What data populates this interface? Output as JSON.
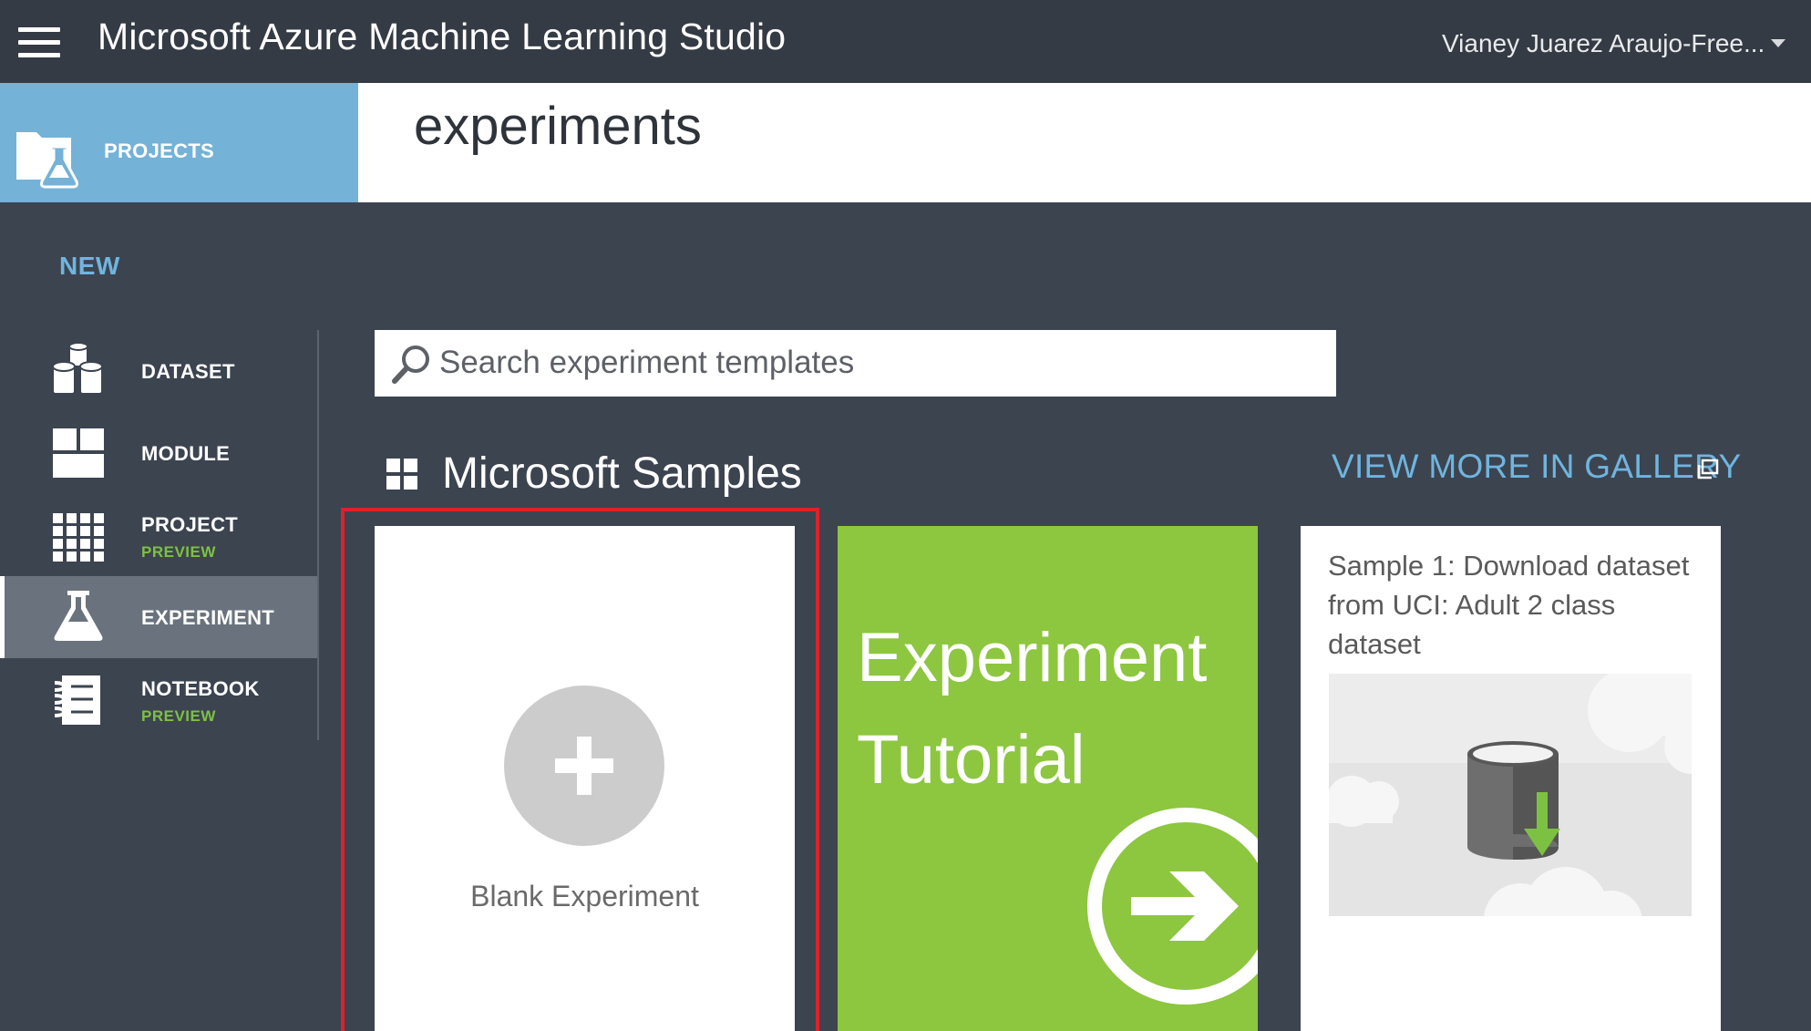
{
  "topbar": {
    "app_title": "Microsoft Azure Machine Learning Studio",
    "user_name": "Vianey Juarez Araujo-Free..."
  },
  "header": {
    "projects_label": "PROJECTS",
    "page_title": "experiments"
  },
  "nav": {
    "new_label": "NEW",
    "items": [
      {
        "label": "DATASET",
        "icon": "dataset-icon"
      },
      {
        "label": "MODULE",
        "icon": "module-icon"
      },
      {
        "label": "PROJECT",
        "sub": "PREVIEW",
        "icon": "project-icon"
      },
      {
        "label": "EXPERIMENT",
        "icon": "experiment-icon",
        "selected": true
      },
      {
        "label": "NOTEBOOK",
        "sub": "PREVIEW",
        "icon": "notebook-icon"
      }
    ]
  },
  "search": {
    "placeholder": "Search experiment templates"
  },
  "samples": {
    "title": "Microsoft Samples",
    "gallery_link": "VIEW MORE IN GALLERY",
    "cards": [
      {
        "label": "Blank Experiment"
      },
      {
        "line1": "Experiment",
        "line2": "Tutorial"
      },
      {
        "title": "Sample 1: Download dataset from UCI: Adult 2 class dataset"
      }
    ]
  },
  "colors": {
    "topbar": "#353b44",
    "body": "#3c4450",
    "accent_blue": "#6fb5df",
    "projects_tile": "#74b2d7",
    "tutorial_green": "#8dc63f",
    "preview_green": "#7dc142",
    "highlight_red": "#e0202a"
  }
}
